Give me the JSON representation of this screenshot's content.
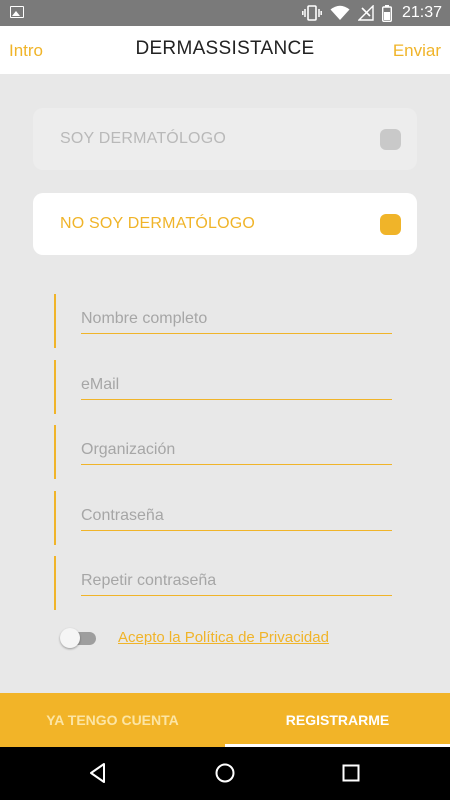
{
  "status_bar": {
    "time": "21:37",
    "icons": [
      "image-icon",
      "vibrate-icon",
      "wifi-icon",
      "no-signal-icon",
      "battery-icon"
    ]
  },
  "header": {
    "left_action": "Intro",
    "title": "DERMASSISTANCE",
    "right_action": "Enviar"
  },
  "options": {
    "soy": {
      "label": "SOY DERMATÓLOGO",
      "selected": false
    },
    "no_soy": {
      "label": "NO SOY DERMATÓLOGO",
      "selected": true
    }
  },
  "form": {
    "name": {
      "placeholder": "Nombre completo",
      "value": ""
    },
    "email": {
      "placeholder": "eMail",
      "value": ""
    },
    "organization": {
      "placeholder": "Organización",
      "value": ""
    },
    "password": {
      "placeholder": "Contraseña",
      "value": ""
    },
    "repeat_password": {
      "placeholder": "Repetir contraseña",
      "value": ""
    }
  },
  "privacy": {
    "accepted": false,
    "label": "Acepto la Política de Privacidad"
  },
  "tabs": {
    "login": "YA TENGO CUENTA",
    "register": "REGISTRARME",
    "active": "register"
  },
  "colors": {
    "accent": "#f0b429",
    "tab_bar": "#f2b428",
    "background": "#e8e8e8",
    "status_bar": "#7a7a7a"
  },
  "nav_bar": {
    "icons": [
      "back-icon",
      "home-icon",
      "recents-icon"
    ]
  }
}
